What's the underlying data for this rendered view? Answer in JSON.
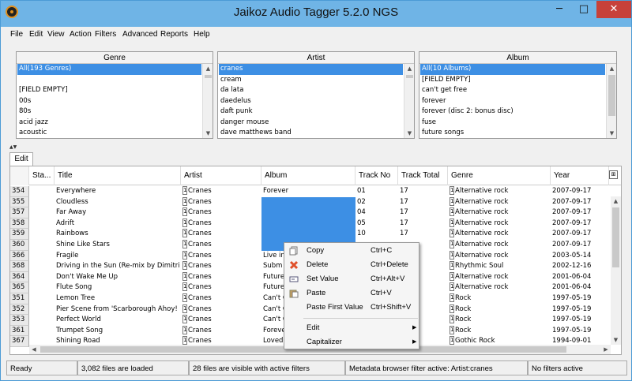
{
  "window": {
    "title": "Jaikoz Audio Tagger 5.2.0 NGS",
    "minimize": "─",
    "maximize": "□",
    "close": "✕"
  },
  "menu": [
    "File",
    "Edit",
    "View",
    "Action",
    "Filters",
    "Advanced",
    "Reports",
    "Help"
  ],
  "browser": {
    "genre": {
      "header": "Genre",
      "items": [
        "All(193 Genres)",
        "",
        "[FIELD EMPTY]",
        "00s",
        "80s",
        "acid jazz",
        "acoustic"
      ]
    },
    "artist": {
      "header": "Artist",
      "items": [
        "cranes",
        "cream",
        "da lata",
        "daedelus",
        "daft punk",
        "danger mouse",
        "dave matthews band"
      ]
    },
    "album": {
      "header": "Album",
      "items": [
        "All(10 Albums)",
        "[FIELD EMPTY]",
        "can't get free",
        "forever",
        "forever (disc 2: bonus disc)",
        "fuse",
        "future songs"
      ]
    }
  },
  "tab": "Edit",
  "columns": [
    "Sta...",
    "Title",
    "Artist",
    "Album",
    "Track No",
    "Track Total",
    "Genre",
    "Year"
  ],
  "rows": [
    {
      "n": "354",
      "title": "Everywhere",
      "artist": "Cranes",
      "album": "Forever",
      "track": "01",
      "total": "17",
      "genre": "Alternative rock",
      "year": "2007-09-17"
    },
    {
      "n": "355",
      "title": "Cloudless",
      "artist": "Cranes",
      "album": "",
      "track": "02",
      "total": "17",
      "genre": "Alternative rock",
      "year": "2007-09-17"
    },
    {
      "n": "357",
      "title": "Far Away",
      "artist": "Cranes",
      "album": "",
      "track": "04",
      "total": "17",
      "genre": "Alternative rock",
      "year": "2007-09-17"
    },
    {
      "n": "358",
      "title": "Adrift",
      "artist": "Cranes",
      "album": "",
      "track": "05",
      "total": "17",
      "genre": "Alternative rock",
      "year": "2007-09-17"
    },
    {
      "n": "359",
      "title": "Rainbows",
      "artist": "Cranes",
      "album": "",
      "track": "10",
      "total": "17",
      "genre": "Alternative rock",
      "year": "2007-09-17"
    },
    {
      "n": "360",
      "title": "Shine Like Stars",
      "artist": "Cranes",
      "album": "",
      "track": "",
      "total": "",
      "genre": "Alternative rock",
      "year": "2007-09-17"
    },
    {
      "n": "366",
      "title": "Fragile",
      "artist": "Cranes",
      "album": "Live in",
      "track": "",
      "total": "",
      "genre": "Alternative rock",
      "year": "2003-05-14"
    },
    {
      "n": "368",
      "title": "Driving in the Sun (Re-mix by Dimitri",
      "artist": "Cranes",
      "album": "Subm",
      "track": "",
      "total": "",
      "genre": "Rhythmic Soul",
      "year": "2002-12-16"
    },
    {
      "n": "364",
      "title": "Don't Wake Me Up",
      "artist": "Cranes",
      "album": "Future",
      "track": "",
      "total": "",
      "genre": "Alternative rock",
      "year": "2001-06-04"
    },
    {
      "n": "365",
      "title": "Flute Song",
      "artist": "Cranes",
      "album": "Future",
      "track": "",
      "total": "",
      "genre": "Alternative rock",
      "year": "2001-06-04"
    },
    {
      "n": "351",
      "title": "Lemon Tree",
      "artist": "Cranes",
      "album": "Can't C",
      "track": "",
      "total": "",
      "genre": "Rock",
      "year": "1997-05-19"
    },
    {
      "n": "352",
      "title": "Pier Scene from 'Scarborough Ahoy!",
      "artist": "Cranes",
      "album": "Can't C",
      "track": "",
      "total": "",
      "genre": "Rock",
      "year": "1997-05-19"
    },
    {
      "n": "353",
      "title": "Perfect World",
      "artist": "Cranes",
      "album": "Can't C",
      "track": "",
      "total": "",
      "genre": "Rock",
      "year": "1997-05-19"
    },
    {
      "n": "361",
      "title": "Trumpet Song",
      "artist": "Cranes",
      "album": "Foreve",
      "track": "",
      "total": "",
      "genre": "Rock",
      "year": "1997-05-19"
    },
    {
      "n": "367",
      "title": "Shining Road",
      "artist": "Cranes",
      "album": "Loved",
      "track": "",
      "total": "",
      "genre": "Gothic Rock",
      "year": "1994-09-01"
    }
  ],
  "context_menu": {
    "copy": {
      "label": "Copy",
      "shortcut": "Ctrl+C"
    },
    "delete": {
      "label": "Delete",
      "shortcut": "Ctrl+Delete"
    },
    "set_value": {
      "label": "Set Value",
      "shortcut": "Ctrl+Alt+V"
    },
    "paste": {
      "label": "Paste",
      "shortcut": "Ctrl+V"
    },
    "paste_first": {
      "label": "Paste First Value",
      "shortcut": "Ctrl+Shift+V"
    },
    "edit": {
      "label": "Edit"
    },
    "capitalizer": {
      "label": "Capitalizer"
    }
  },
  "status": {
    "ready": "Ready",
    "loaded": "3,082 files are loaded",
    "visible": "28 files are visible with active filters",
    "metadata": "Metadata browser filter active: Artist:cranes",
    "filters": "No filters active"
  },
  "colors": {
    "selection": "#3d8fe4",
    "titlebar": "#6fb4e6",
    "close": "#c7413a"
  }
}
